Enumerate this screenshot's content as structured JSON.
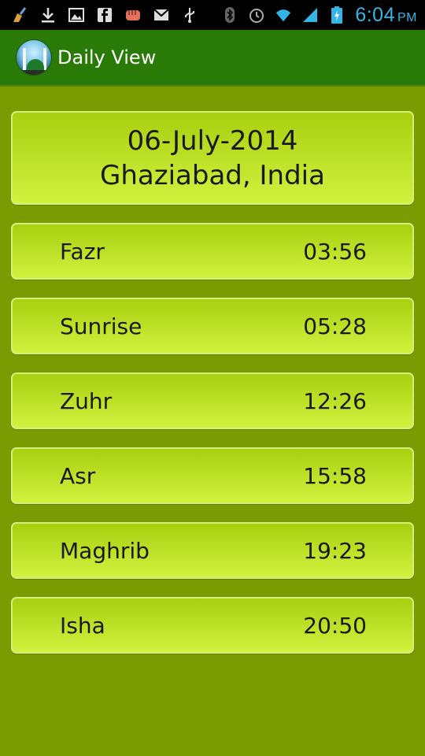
{
  "status_bar": {
    "time": "6:04",
    "ampm": "PM",
    "left_icons": [
      "cleaner-icon",
      "download-icon",
      "image-icon",
      "facebook-icon",
      "fist-icon",
      "gmail-icon",
      "usb-icon"
    ],
    "right_icons": [
      "bluetooth-icon",
      "alarm-icon",
      "wifi-icon",
      "signal-icon",
      "battery-icon"
    ]
  },
  "action_bar": {
    "title": "Daily View"
  },
  "header": {
    "date": "06-July-2014",
    "location": "Ghaziabad, India"
  },
  "prayers": [
    {
      "name": "Fazr",
      "time": "03:56"
    },
    {
      "name": "Sunrise",
      "time": "05:28"
    },
    {
      "name": "Zuhr",
      "time": "12:26"
    },
    {
      "name": "Asr",
      "time": "15:58"
    },
    {
      "name": "Maghrib",
      "time": "19:23"
    },
    {
      "name": "Isha",
      "time": "20:50"
    }
  ]
}
